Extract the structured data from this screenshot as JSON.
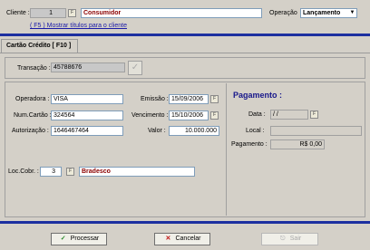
{
  "header": {
    "cliente_label": "Cliente :",
    "cliente_code": "1",
    "cliente_name": "Consumidor",
    "operacao_label": "Operação",
    "operacao_value": "Lançamento",
    "link_text": "( F5 ) Mostrar títulos para o cliente"
  },
  "tab": {
    "label": "Cartão Crédito  [ F10 ]"
  },
  "transacao": {
    "label": "Transação :",
    "value": "45788676"
  },
  "form": {
    "operadora_label": "Operadora :",
    "operadora_value": "VISA",
    "numcartao_label": "Num.Cartão :",
    "numcartao_value": "324564",
    "autorizacao_label": "Autorização :",
    "autorizacao_value": "1646467464",
    "emissao_label": "Emissão :",
    "emissao_value": "15/09/2006",
    "vencimento_label": "Vencimento :",
    "vencimento_value": "15/10/2006",
    "valor_label": "Valor :",
    "valor_value": "10.000.000",
    "loccobr_label": "Loc.Cobr. :",
    "loccobr_code": "3",
    "loccobr_name": "Bradesco"
  },
  "pagamento": {
    "title": "Pagamento :",
    "data_label": "Data :",
    "data_value": "/ /",
    "local_label": "Local :",
    "local_value": "",
    "pag_label": "Pagamento :",
    "pag_value": "R$ 0,00"
  },
  "buttons": {
    "processar": "Processar",
    "cancelar": "Cancelar",
    "sair": "Sair"
  },
  "colors": {
    "accent_bar": "#1c2fa0",
    "brand_text": "#8b0000",
    "link": "#1a1aa8",
    "panel_title": "#16168a"
  }
}
